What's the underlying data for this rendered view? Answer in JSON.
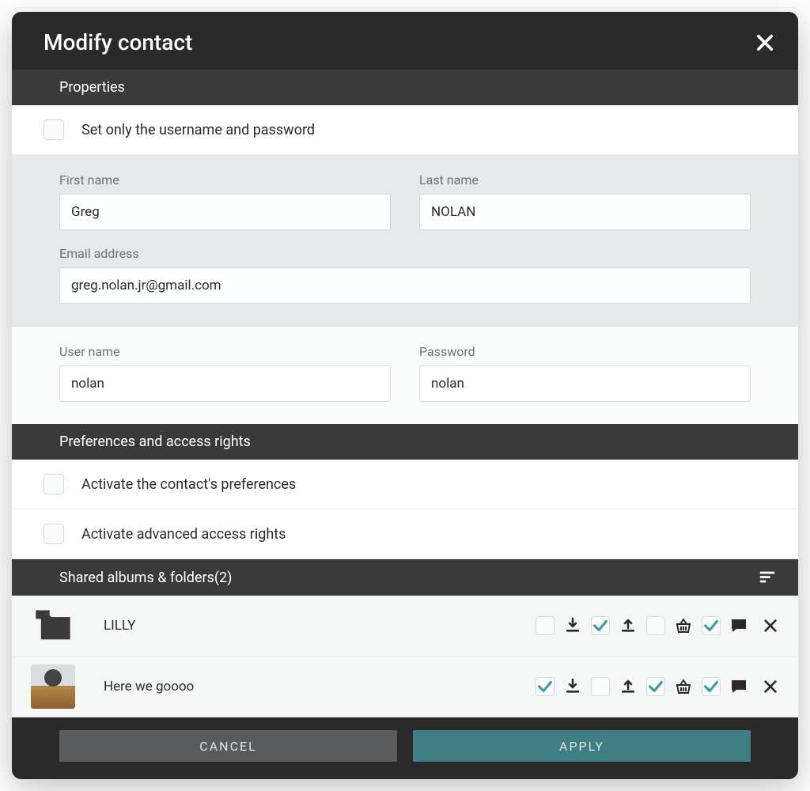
{
  "dialog": {
    "title": "Modify contact"
  },
  "sections": {
    "properties_title": "Properties",
    "prefs_title": "Preferences and access rights",
    "shared_title": "Shared albums & folders(2)"
  },
  "checks": {
    "only_username": "Set only the username and password",
    "activate_prefs": "Activate the contact's preferences",
    "activate_advanced": "Activate advanced access rights"
  },
  "fields": {
    "first_name_label": "First name",
    "first_name_value": "Greg",
    "last_name_label": "Last name",
    "last_name_value": "NOLAN",
    "email_label": "Email address",
    "email_value": "greg.nolan.jr@gmail.com",
    "user_label": "User name",
    "user_value": "nolan",
    "pass_label": "Password",
    "pass_value": "nolan"
  },
  "shared": [
    {
      "name": "LILLY",
      "type": "folder",
      "perms": [
        false,
        true,
        false,
        true,
        true
      ]
    },
    {
      "name": "Here we goooo",
      "type": "photo",
      "perms": [
        true,
        false,
        true,
        true,
        true
      ]
    }
  ],
  "footer": {
    "cancel": "CANCEL",
    "apply": "APPLY"
  }
}
